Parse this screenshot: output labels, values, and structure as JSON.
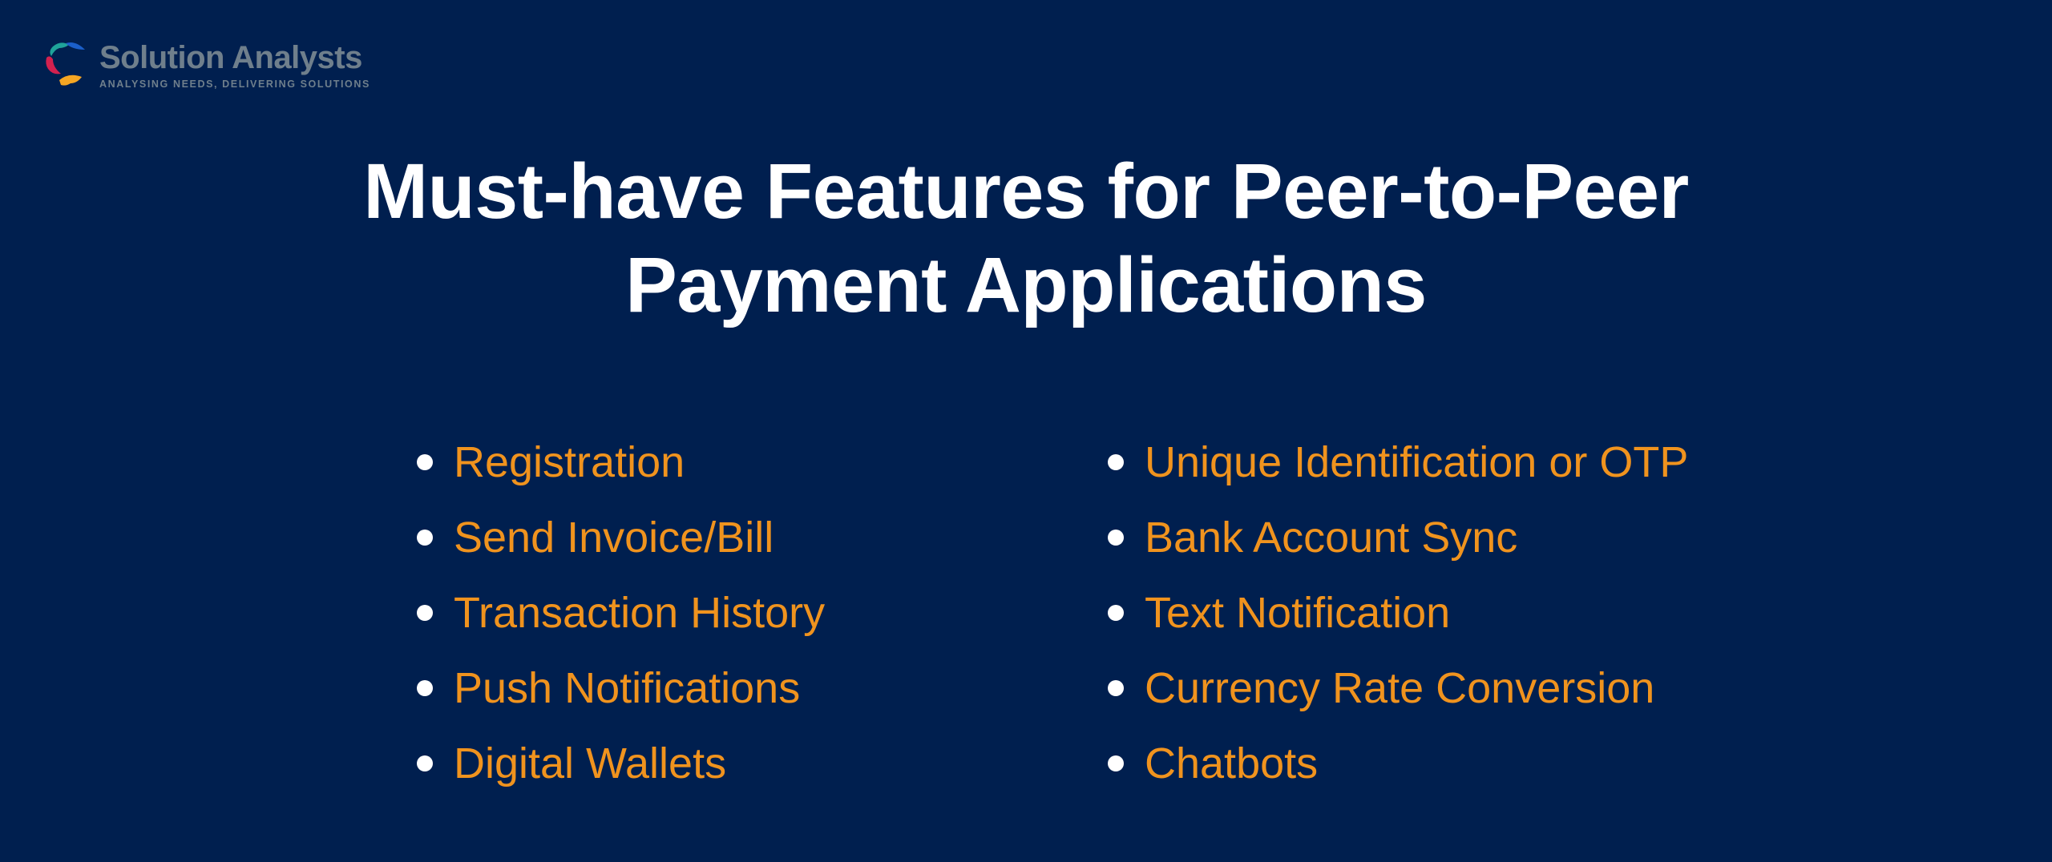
{
  "brand": {
    "name": "Solution Analysts",
    "tagline": "ANALYSING NEEDS, DELIVERING SOLUTIONS",
    "logo_icon": "pinwheel-logo-icon",
    "colors": [
      "#1fa39a",
      "#1b5fc9",
      "#d3214f",
      "#f5a623"
    ]
  },
  "title": {
    "line1": "Must-have Features for Peer-to-Peer",
    "line2": "Payment Applications"
  },
  "features": {
    "left": [
      {
        "label": "Registration"
      },
      {
        "label": "Send Invoice/Bill"
      },
      {
        "label": "Transaction History"
      },
      {
        "label": "Push Notifications"
      },
      {
        "label": "Digital Wallets"
      }
    ],
    "right": [
      {
        "label": "Unique Identification or OTP"
      },
      {
        "label": "Bank Account Sync"
      },
      {
        "label": "Text Notification"
      },
      {
        "label": "Currency Rate Conversion"
      },
      {
        "label": "Chatbots"
      }
    ]
  },
  "colors": {
    "background": "#001f4f",
    "title": "#ffffff",
    "feature_text": "#f0931e",
    "bullet": "#ffffff"
  }
}
